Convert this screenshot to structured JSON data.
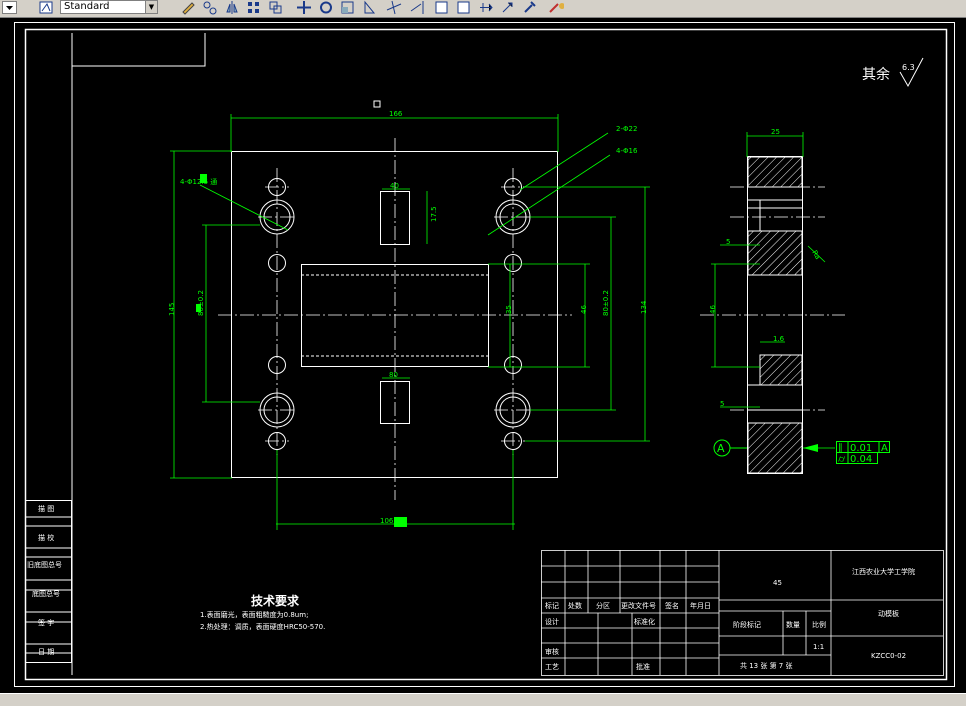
{
  "toolbar": {
    "style_combo_value": "Standard",
    "icons": [
      "layer-dropdown",
      "text-style-icon",
      "pencil-icon",
      "properties-icon",
      "mirror-icon",
      "array-icon",
      "copy-icon",
      "move-icon",
      "rotate-icon",
      "scale-icon",
      "stretch-icon",
      "trim-icon",
      "extend-icon",
      "break-icon",
      "chamfer-icon",
      "fillet-icon",
      "explode-icon",
      "help-icon"
    ]
  },
  "colors": {
    "drawing_bg": "#000000",
    "border": "#ffffff",
    "dimension": "#00ff00",
    "geometry": "#ffffff"
  },
  "drawing": {
    "roughness_note": {
      "text": "其余",
      "value": "6.3"
    },
    "dims": {
      "top_width": "166",
      "left_height": "145",
      "inner_width": "40",
      "slot_height": "17.5",
      "pcd_left": "80±0.2",
      "pcd_right": "80±0.2",
      "height_134": "134",
      "height_46": "46",
      "height_35": "35",
      "inner_80": "80",
      "bottom_width": "106",
      "hole_label_left": "4-Φ12.5 通",
      "hole_label_right1": "2-Φ22",
      "hole_label_right2": "4-Φ16",
      "side_width": "25",
      "side_height": "46",
      "side_dim_5a": "5",
      "side_dim_5b": "5",
      "side_dim_15": "1.6",
      "side_dim_angle": "Ra"
    },
    "datum_label": "A",
    "gdt": [
      {
        "symbol": "∥",
        "value": "0.01",
        "datum": "A"
      },
      {
        "symbol": "⌭",
        "value": "0.04",
        "datum": ""
      }
    ],
    "tech_req": {
      "title": "技术要求",
      "line1": "1.表面磨光，表面粗糙度为0.8um;",
      "line2": "2.热处理：调质，表面硬度HRC50-570."
    },
    "left_strip": [
      "描 图",
      "描 校",
      "旧底图总号",
      "底图总号",
      "签 字",
      "日 期"
    ],
    "title_block": {
      "material": "45",
      "school": "江西农业大学工学院",
      "part_name": "动模板",
      "drawing_no": "KZCC0-02",
      "scale": "1:1",
      "sheets": "共 13 张  第 7 张",
      "h_biaoji": "标记",
      "h_chushu": "处数",
      "h_fenqu": "分区",
      "h_gengwen": "更改文件号",
      "h_qianming": "签名",
      "h_nianyue": "年月日",
      "sheji": "设计",
      "biaozhunhua": "标准化",
      "jieduan": "阶段标记",
      "shuliang": "数量",
      "bili": "比例",
      "shenhe": "审核",
      "gongyi": "工艺",
      "pizhun": "批准"
    }
  }
}
